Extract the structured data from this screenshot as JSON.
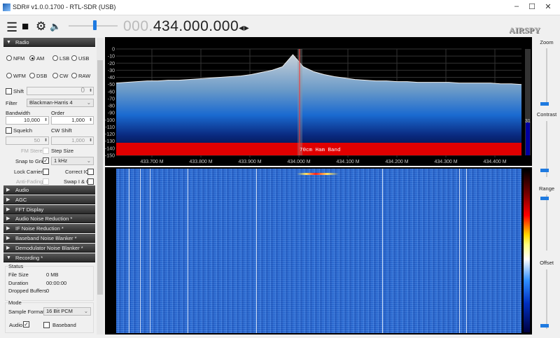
{
  "window": {
    "title": "SDR# v1.0.0.1700 - RTL-SDR (USB)",
    "minimize": "–",
    "maximize": "☐",
    "close": "✕"
  },
  "toolbar": {
    "menu_icon": "☰",
    "stop_icon": "■",
    "settings_icon": "⚙",
    "volume_icon": "🔈",
    "freq_prefix": "000.",
    "frequency": "434.000.000",
    "tune_arrows": "◂▸",
    "volume_percent": 40,
    "brand": "AIRSPY"
  },
  "radio": {
    "header": "Radio",
    "modes": [
      "NFM",
      "AM",
      "LSB",
      "USB",
      "WFM",
      "DSB",
      "CW",
      "RAW"
    ],
    "selected_mode": "AM",
    "shift_label": "Shift",
    "shift_value": "0",
    "filter_label": "Filter",
    "filter_value": "Blackman-Harris 4",
    "bandwidth_label": "Bandwidth",
    "bandwidth_value": "10,000",
    "order_label": "Order",
    "order_value": "1,000",
    "squelch_label": "Squelch",
    "squelch_value": "50",
    "cw_shift_label": "CW Shift",
    "cw_shift_value": "1,000",
    "fm_stereo_label": "FM Stereo",
    "step_size_label": "Step Size",
    "snap_label": "Snap to Grid",
    "step_value": "1 kHz",
    "lock_carrier_label": "Lock Carrier",
    "correct_iq_label": "Correct IQ",
    "anti_fading_label": "Anti-Fading",
    "swap_iq_label": "Swap I & Q"
  },
  "sections": [
    "Audio",
    "AGC",
    "FFT Display",
    "Audio Noise Reduction *",
    "IF Noise Reduction *",
    "Baseband Noise Blanker *",
    "Demodulator Noise Blanker *"
  ],
  "recording": {
    "header": "Recording *",
    "status_label": "Status",
    "file_size_label": "File Size",
    "file_size": "0 MB",
    "duration_label": "Duration",
    "duration": "00:00:00",
    "dropped_label": "Dropped Buffers",
    "dropped": "0",
    "mode_label": "Mode",
    "sample_format_label": "Sample Format",
    "sample_format": "16 Bit PCM",
    "audio_label": "Audio",
    "baseband_label": "Baseband"
  },
  "spectrum": {
    "y_ticks": [
      "0",
      "-10",
      "-20",
      "-30",
      "-40",
      "-50",
      "-60",
      "-70",
      "-80",
      "-90",
      "-100",
      "-110",
      "-120",
      "-130",
      "-140",
      "-150"
    ],
    "x_ticks": [
      "433.700 M",
      "433.800 M",
      "433.900 M",
      "434.000 M",
      "434.100 M",
      "434.200 M",
      "434.300 M",
      "434.400 M"
    ],
    "band_label": "70cm Ham Band",
    "gain_value": "31",
    "trace_db": [
      -48,
      -47,
      -46,
      -45,
      -45,
      -44,
      -44,
      -43,
      -42,
      -41,
      -40,
      -39,
      -38,
      -36,
      -33,
      -30,
      -25,
      -8,
      -25,
      -32,
      -36,
      -39,
      -41,
      -43,
      -44,
      -45,
      -45,
      -46,
      -46,
      -47,
      -47,
      -47,
      -47,
      -48,
      -48,
      -48,
      -48,
      -49,
      -49,
      -50
    ]
  },
  "controls": {
    "zoom": "Zoom",
    "contrast": "Contrast",
    "range": "Range",
    "offset": "Offset"
  },
  "colors": {
    "accent": "#1e7ae0",
    "band": "#e00000",
    "marker": "#ff3030"
  }
}
